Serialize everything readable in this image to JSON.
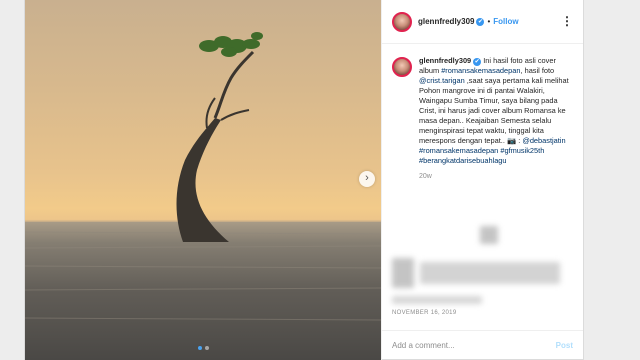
{
  "post": {
    "username": "glennfredly309",
    "verified_mark": "✔",
    "separator": "•",
    "follow_label": "Follow",
    "more_label": "⋮",
    "caption": {
      "username": "glennfredly309",
      "verified_mark": "✔",
      "text_1": " Ini hasil foto asli cover album ",
      "tag_1": "#romansakemasadepan",
      "text_2": ", hasil foto ",
      "mention_1": "@crist.tarigan",
      "text_3": " ,saat saya pertama kali melihat Pohon mangrove ini di pantai Walakiri, Waingapu Sumba Timur, saya bilang pada Crist, ini harus jadi cover album Romansa ke masa depan.. Keajaiban Semesta selalu menginspirasi tepat waktu, tinggal kita merespons dengan tepat.. ",
      "emoji": "📷",
      "text_4": " : ",
      "mention_2": "@debastjatin",
      "text_5": " ",
      "tag_2": "#romansakemasadepan",
      "text_6": " ",
      "tag_3": "#gfmusik25th",
      "text_7": " ",
      "tag_4": "#berangkatdarisebuahlagu",
      "time": "20w"
    },
    "date": "NOVEMBER 16, 2019",
    "comment_placeholder": "Add a comment...",
    "post_label": "Post",
    "carousel": {
      "next_icon": "›",
      "slide_count": 2,
      "active_slide": 1
    },
    "colors": {
      "accent": "#3897f0",
      "text": "#262626",
      "muted": "#8e8e8e",
      "story_ring": "#e0234f"
    }
  }
}
